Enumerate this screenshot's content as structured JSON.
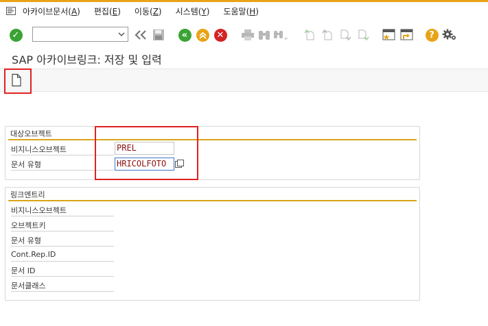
{
  "menu": {
    "items": [
      {
        "label": "아카이브문서",
        "key": "A"
      },
      {
        "label": "편집",
        "key": "E"
      },
      {
        "label": "이동",
        "key": "Z"
      },
      {
        "label": "시스템",
        "key": "Y"
      },
      {
        "label": "도움말",
        "key": "H"
      }
    ]
  },
  "toolbar": {
    "command_value": "",
    "colors": {
      "green": "#3aa335",
      "orange": "#e8a317",
      "red": "#d42424",
      "gray": "#b7b7b7"
    }
  },
  "page": {
    "title": "SAP 아카이브링크: 저장 및 입력"
  },
  "target_object": {
    "title": "대상오브젝트",
    "business_object_label": "비지니스오브젝트",
    "business_object_value": "PREL",
    "document_type_label": "문서 유형",
    "document_type_value": "HRICOLFOTO"
  },
  "link_entry": {
    "title": "링크엔트리",
    "labels": [
      "비지니스오브젝트",
      "오브젝트키",
      "문서 유형",
      "Cont.Rep.ID",
      "문서 ID",
      "문서클래스"
    ]
  }
}
